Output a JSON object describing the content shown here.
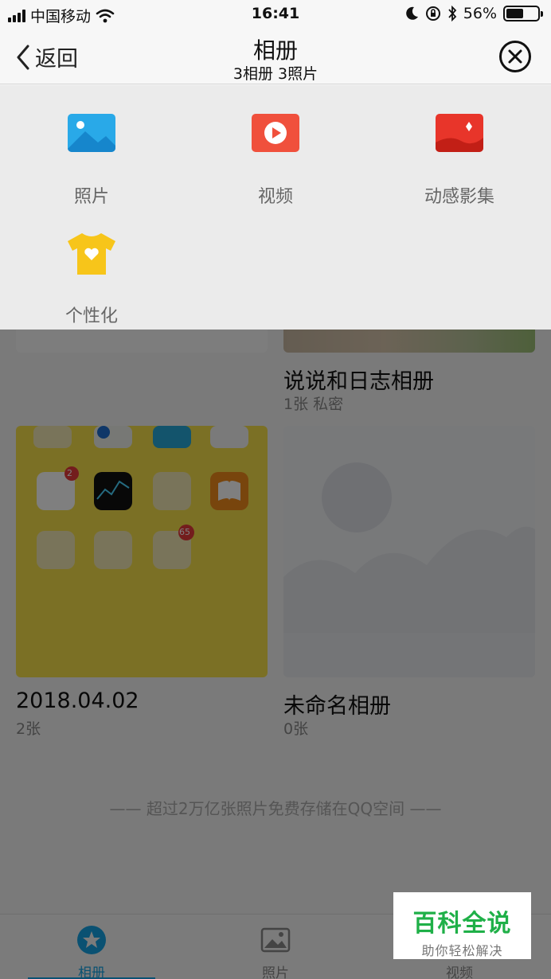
{
  "status_bar": {
    "carrier": "中国移动",
    "time": "16:41",
    "battery": "56%",
    "battery_level": 0.56
  },
  "nav": {
    "back_label": "返回",
    "title": "相册",
    "subtitle": "3相册 3照片"
  },
  "albums": [
    {
      "name": "说说和日志相册",
      "meta": "1张  私密"
    },
    {
      "name": "2018.04.02",
      "meta": "2张"
    },
    {
      "name": "未命名相册",
      "meta": "0张"
    }
  ],
  "cover_badges": [
    "2",
    "65"
  ],
  "footer_note": "—— 超过2万亿张照片免费存储在QQ空间 ——",
  "tabs": [
    {
      "label": "相册",
      "icon": "album-star-icon",
      "active": true
    },
    {
      "label": "照片",
      "icon": "photo-icon",
      "active": false
    },
    {
      "label": "视频",
      "icon": "video-icon",
      "active": false
    }
  ],
  "menu": {
    "items": [
      {
        "label": "照片",
        "icon": "photo-icon",
        "color": "#29a9e8"
      },
      {
        "label": "视频",
        "icon": "video-play-icon",
        "color": "#f0503c"
      },
      {
        "label": "动感影集",
        "icon": "dynamic-album-icon",
        "color": "#e8352a"
      },
      {
        "label": "个性化",
        "icon": "tshirt-icon",
        "color": "#f7c51a"
      }
    ]
  },
  "watermark": {
    "main": "百科全说",
    "sub": "助你轻松解决"
  },
  "colors": {
    "accent": "#14a3e4",
    "menu_bg": "#ebebeb"
  }
}
